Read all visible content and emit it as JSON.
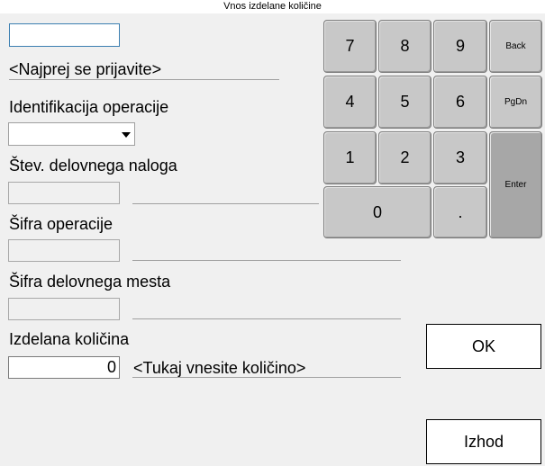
{
  "window": {
    "title": "Vnos izdelane količine"
  },
  "login": {
    "value": "",
    "message": "<Najprej se prijavite>"
  },
  "operation_id": {
    "label": "Identifikacija operacije",
    "selected": ""
  },
  "work_order": {
    "label": "Štev. delovnega naloga",
    "value": "",
    "info": ""
  },
  "operation_code": {
    "label": "Šifra operacije",
    "value": "",
    "info": ""
  },
  "workplace_code": {
    "label": "Šifra delovnega mesta",
    "value": "",
    "info": ""
  },
  "quantity": {
    "label": "Izdelana količina",
    "value": "0",
    "hint": "<Tukaj vnesite količino>"
  },
  "keypad": {
    "k7": "7",
    "k8": "8",
    "k9": "9",
    "back": "Back",
    "k4": "4",
    "k5": "5",
    "k6": "6",
    "pgdn": "PgDn",
    "k1": "1",
    "k2": "2",
    "k3": "3",
    "enter": "Enter",
    "k0": "0",
    "dot": "."
  },
  "buttons": {
    "ok": "OK",
    "exit": "Izhod"
  }
}
